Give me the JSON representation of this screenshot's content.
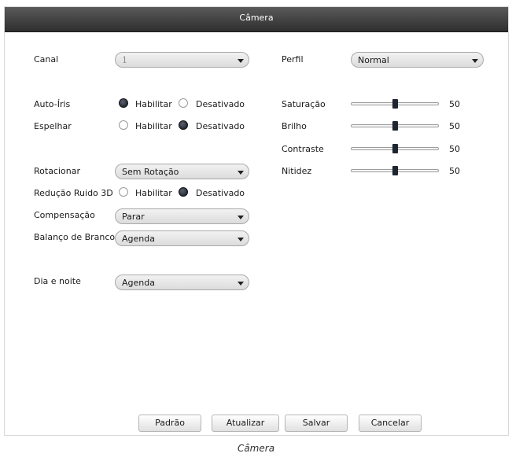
{
  "window": {
    "title": "Câmera"
  },
  "left": {
    "canal": {
      "label": "Canal",
      "value": "1"
    },
    "auto_iris": {
      "label": "Auto-Íris",
      "opt1": "Habilitar",
      "opt2": "Desativado",
      "selected": "Habilitar"
    },
    "espelhar": {
      "label": "Espelhar",
      "opt1": "Habilitar",
      "opt2": "Desativado",
      "selected": "Desativado"
    },
    "rotacionar": {
      "label": "Rotacionar",
      "value": "Sem Rotação"
    },
    "reducao_ruido": {
      "label": "Redução Ruido 3D",
      "opt1": "Habilitar",
      "opt2": "Desativado",
      "selected": "Desativado"
    },
    "compensacao": {
      "label": "Compensação",
      "value": "Parar"
    },
    "balanco_branco": {
      "label": "Balanço de Branco",
      "value": "Agenda"
    },
    "dia_noite": {
      "label": "Dia e noite",
      "value": "Agenda"
    }
  },
  "right": {
    "perfil": {
      "label": "Perfil",
      "value": "Normal"
    },
    "saturacao": {
      "label": "Saturação",
      "value": "50",
      "level": 0.5
    },
    "brilho": {
      "label": "Brilho",
      "value": "50",
      "level": 0.5
    },
    "contraste": {
      "label": "Contraste",
      "value": "50",
      "level": 0.5
    },
    "nitidez": {
      "label": "Nitidez",
      "value": "50",
      "level": 0.5
    }
  },
  "buttons": {
    "default": "Padrão",
    "refresh": "Atualizar",
    "save": "Salvar",
    "cancel": "Cancelar"
  },
  "caption": "Câmera"
}
